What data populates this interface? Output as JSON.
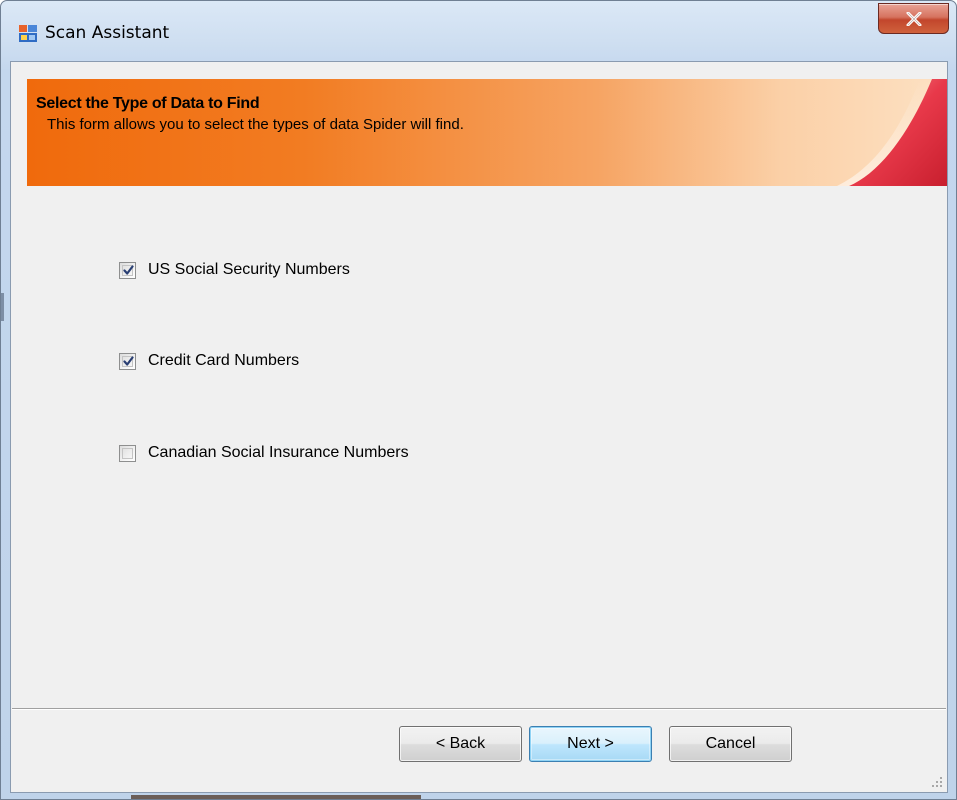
{
  "window": {
    "title": "Scan Assistant",
    "close_label": "x"
  },
  "banner": {
    "title": "Select the Type of Data to Find",
    "subtitle": "This form allows you to select the types of data Spider will find."
  },
  "options": [
    {
      "label": "US Social Security Numbers",
      "checked": true
    },
    {
      "label": "Credit Card Numbers",
      "checked": true
    },
    {
      "label": "Canadian Social Insurance Numbers",
      "checked": false
    }
  ],
  "buttons": {
    "back": "< Back",
    "next": "Next >",
    "cancel": "Cancel"
  },
  "colors": {
    "banner_orange": "#f06a0c",
    "accent_red": "#e0303e",
    "default_button_border": "#3c7fb1"
  }
}
